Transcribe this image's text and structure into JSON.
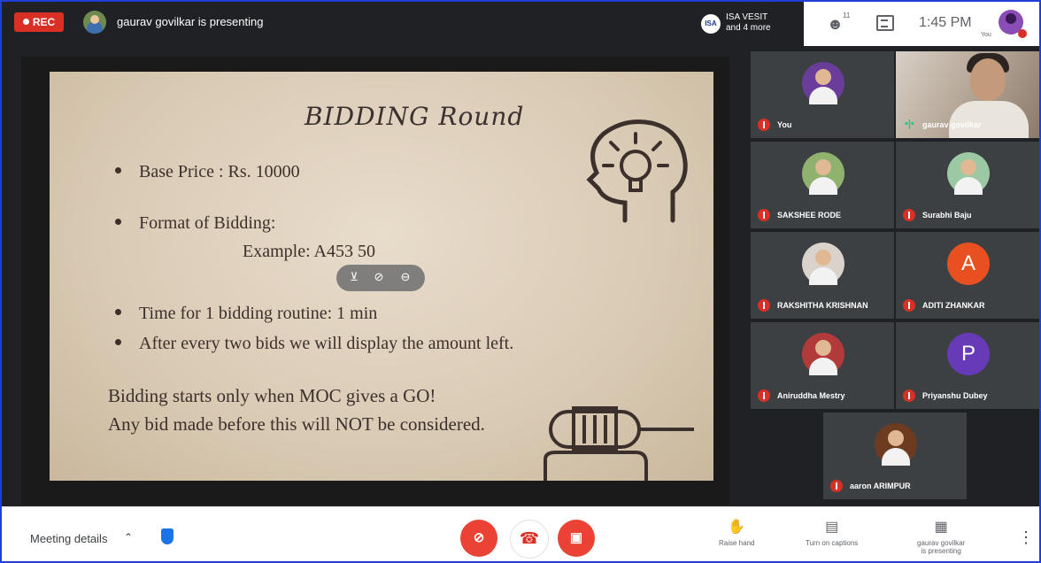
{
  "topbar": {
    "rec_label": "REC",
    "presenting_text": "gaurav govilkar is presenting",
    "isa_logo_text": "ISA",
    "participants_line1": "ISA VESIT",
    "participants_line2": "and 4 more",
    "people_count": "11",
    "time": "1:45 PM",
    "self_label": "You"
  },
  "slide": {
    "title": "BIDDING Round",
    "bullets": [
      "Base Price : Rs. 10000",
      "Format of Bidding:",
      "Time for 1 bidding routine: 1 min",
      "After every two bids we will display the amount left."
    ],
    "example": "Example:  A453 50",
    "note_line1": "Bidding starts only when MOC gives a GO!",
    "note_line2": "Any bid made before this will NOT be considered."
  },
  "participants": [
    {
      "name": "You",
      "avatar": "photo",
      "color": "#6a3d9a"
    },
    {
      "name": "gaurav govilkar",
      "avatar": "camera",
      "color": "#b8aa9b"
    },
    {
      "name": "SAKSHEE RODE",
      "avatar": "photo",
      "color": "#8fb36f"
    },
    {
      "name": "Surabhi Baju",
      "avatar": "photo",
      "color": "#9cc8a4"
    },
    {
      "name": "RAKSHITHA KRISHNAN",
      "avatar": "photo",
      "color": "#d9d3cc"
    },
    {
      "name": "ADITI ZHANKAR",
      "avatar": "letter",
      "letter": "A",
      "color": "#e8501f"
    },
    {
      "name": "Aniruddha Mestry",
      "avatar": "photo",
      "color": "#b33a3a"
    },
    {
      "name": "Priyanshu Dubey",
      "avatar": "letter",
      "letter": "P",
      "color": "#673ab7"
    },
    {
      "name": "aaron ARIMPUR",
      "avatar": "photo",
      "color": "#6d3b1f"
    }
  ],
  "bottombar": {
    "meeting_details": "Meeting details",
    "raise_hand": "Raise hand",
    "captions": "Turn on captions",
    "presenting_line1": "gaurav govilkar",
    "presenting_line2": "is presenting"
  }
}
